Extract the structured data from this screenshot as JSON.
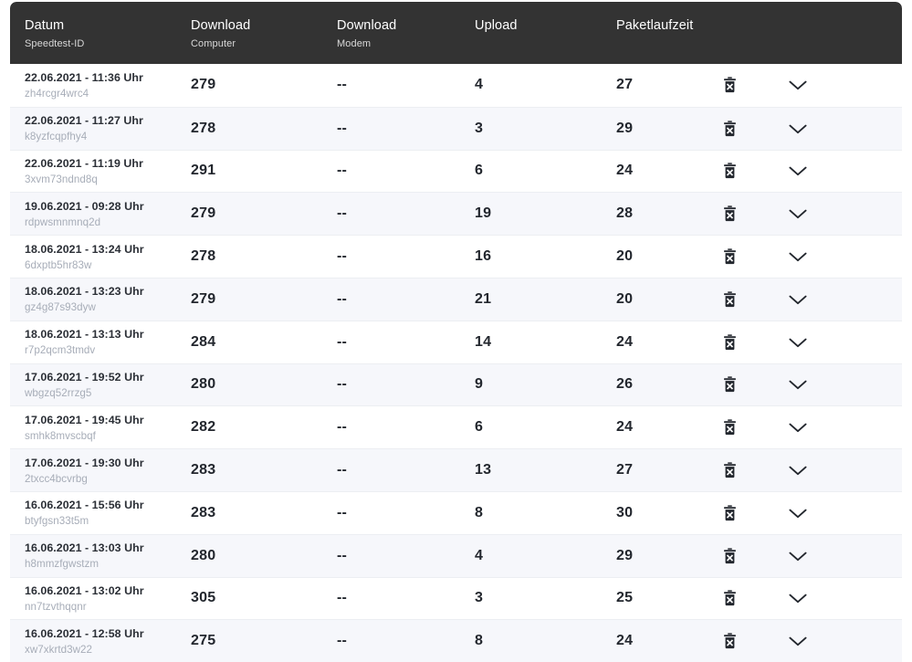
{
  "table": {
    "columns": [
      {
        "key": "date",
        "title": "Datum",
        "subtitle": "Speedtest-ID"
      },
      {
        "key": "dl_comp",
        "title": "Download",
        "subtitle": "Computer"
      },
      {
        "key": "dl_modem",
        "title": "Download",
        "subtitle": "Modem"
      },
      {
        "key": "upload",
        "title": "Upload",
        "subtitle": ""
      },
      {
        "key": "latency",
        "title": "Paketlaufzeit",
        "subtitle": ""
      }
    ],
    "header_background": "#333333",
    "row_background": "#ffffff",
    "row_alt_background": "#f6f7fb",
    "rows": [
      {
        "date": "22.06.2021 - 11:36 Uhr",
        "id": "zh4rcgr4wrc4",
        "dl_comp": "279",
        "dl_modem": "--",
        "upload": "4",
        "latency": "27"
      },
      {
        "date": "22.06.2021 - 11:27 Uhr",
        "id": "k8yzfcqpfhy4",
        "dl_comp": "278",
        "dl_modem": "--",
        "upload": "3",
        "latency": "29"
      },
      {
        "date": "22.06.2021 - 11:19 Uhr",
        "id": "3xvm73ndnd8q",
        "dl_comp": "291",
        "dl_modem": "--",
        "upload": "6",
        "latency": "24"
      },
      {
        "date": "19.06.2021 - 09:28 Uhr",
        "id": "rdpwsmnmnq2d",
        "dl_comp": "279",
        "dl_modem": "--",
        "upload": "19",
        "latency": "28"
      },
      {
        "date": "18.06.2021 - 13:24 Uhr",
        "id": "6dxptb5hr83w",
        "dl_comp": "278",
        "dl_modem": "--",
        "upload": "16",
        "latency": "20"
      },
      {
        "date": "18.06.2021 - 13:23 Uhr",
        "id": "gz4g87s93dyw",
        "dl_comp": "279",
        "dl_modem": "--",
        "upload": "21",
        "latency": "20"
      },
      {
        "date": "18.06.2021 - 13:13 Uhr",
        "id": "r7p2qcm3tmdv",
        "dl_comp": "284",
        "dl_modem": "--",
        "upload": "14",
        "latency": "24"
      },
      {
        "date": "17.06.2021 - 19:52 Uhr",
        "id": "wbgzq52rrzg5",
        "dl_comp": "280",
        "dl_modem": "--",
        "upload": "9",
        "latency": "26"
      },
      {
        "date": "17.06.2021 - 19:45 Uhr",
        "id": "smhk8mvscbqf",
        "dl_comp": "282",
        "dl_modem": "--",
        "upload": "6",
        "latency": "24"
      },
      {
        "date": "17.06.2021 - 19:30 Uhr",
        "id": "2txcc4bcvrbg",
        "dl_comp": "283",
        "dl_modem": "--",
        "upload": "13",
        "latency": "27"
      },
      {
        "date": "16.06.2021 - 15:56 Uhr",
        "id": "btyfgsn33t5m",
        "dl_comp": "283",
        "dl_modem": "--",
        "upload": "8",
        "latency": "30"
      },
      {
        "date": "16.06.2021 - 13:03 Uhr",
        "id": "h8mmzfgwstzm",
        "dl_comp": "280",
        "dl_modem": "--",
        "upload": "4",
        "latency": "29"
      },
      {
        "date": "16.06.2021 - 13:02 Uhr",
        "id": "nn7tzvthqqnr",
        "dl_comp": "305",
        "dl_modem": "--",
        "upload": "3",
        "latency": "25"
      },
      {
        "date": "16.06.2021 - 12:58 Uhr",
        "id": "xw7xkrtd3w22",
        "dl_comp": "275",
        "dl_modem": "--",
        "upload": "8",
        "latency": "24"
      }
    ],
    "row_actions": {
      "delete_icon": "trash-icon",
      "expand_icon": "chevron-down-icon"
    }
  }
}
